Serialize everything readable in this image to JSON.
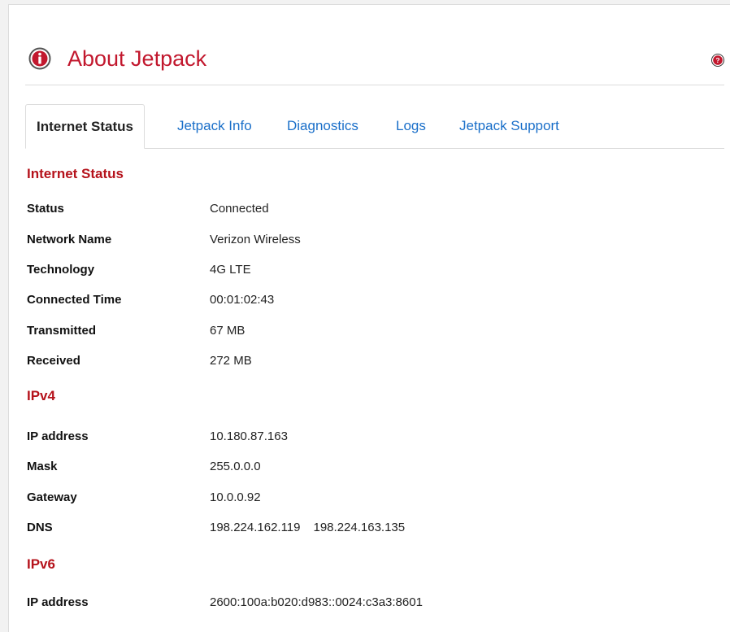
{
  "header": {
    "title": "About Jetpack",
    "icon": "info-icon",
    "help_icon": "help-icon",
    "accent_color": "#c2182e"
  },
  "tabs": [
    {
      "label": "Internet Status",
      "active": true
    },
    {
      "label": "Jetpack Info",
      "active": false
    },
    {
      "label": "Diagnostics",
      "active": false
    },
    {
      "label": "Logs",
      "active": false
    },
    {
      "label": "Jetpack Support",
      "active": false
    }
  ],
  "internet_status": {
    "heading": "Internet Status",
    "rows": [
      {
        "label": "Status",
        "value": "Connected"
      },
      {
        "label": "Network Name",
        "value": "Verizon Wireless"
      },
      {
        "label": "Technology",
        "value": "4G LTE"
      },
      {
        "label": "Connected Time",
        "value": "00:01:02:43"
      },
      {
        "label": "Transmitted",
        "value": "67 MB"
      },
      {
        "label": "Received",
        "value": "272 MB"
      }
    ]
  },
  "ipv4": {
    "heading": "IPv4",
    "rows": [
      {
        "label": "IP address",
        "value": "10.180.87.163"
      },
      {
        "label": "Mask",
        "value": "255.0.0.0"
      },
      {
        "label": "Gateway",
        "value": "10.0.0.92"
      },
      {
        "label": "DNS",
        "value": "198.224.162.119",
        "value2": "198.224.163.135"
      }
    ]
  },
  "ipv6": {
    "heading": "IPv6",
    "rows": [
      {
        "label": "IP address",
        "value": "2600:100a:b020:d983::0024:c3a3:8601"
      }
    ]
  }
}
